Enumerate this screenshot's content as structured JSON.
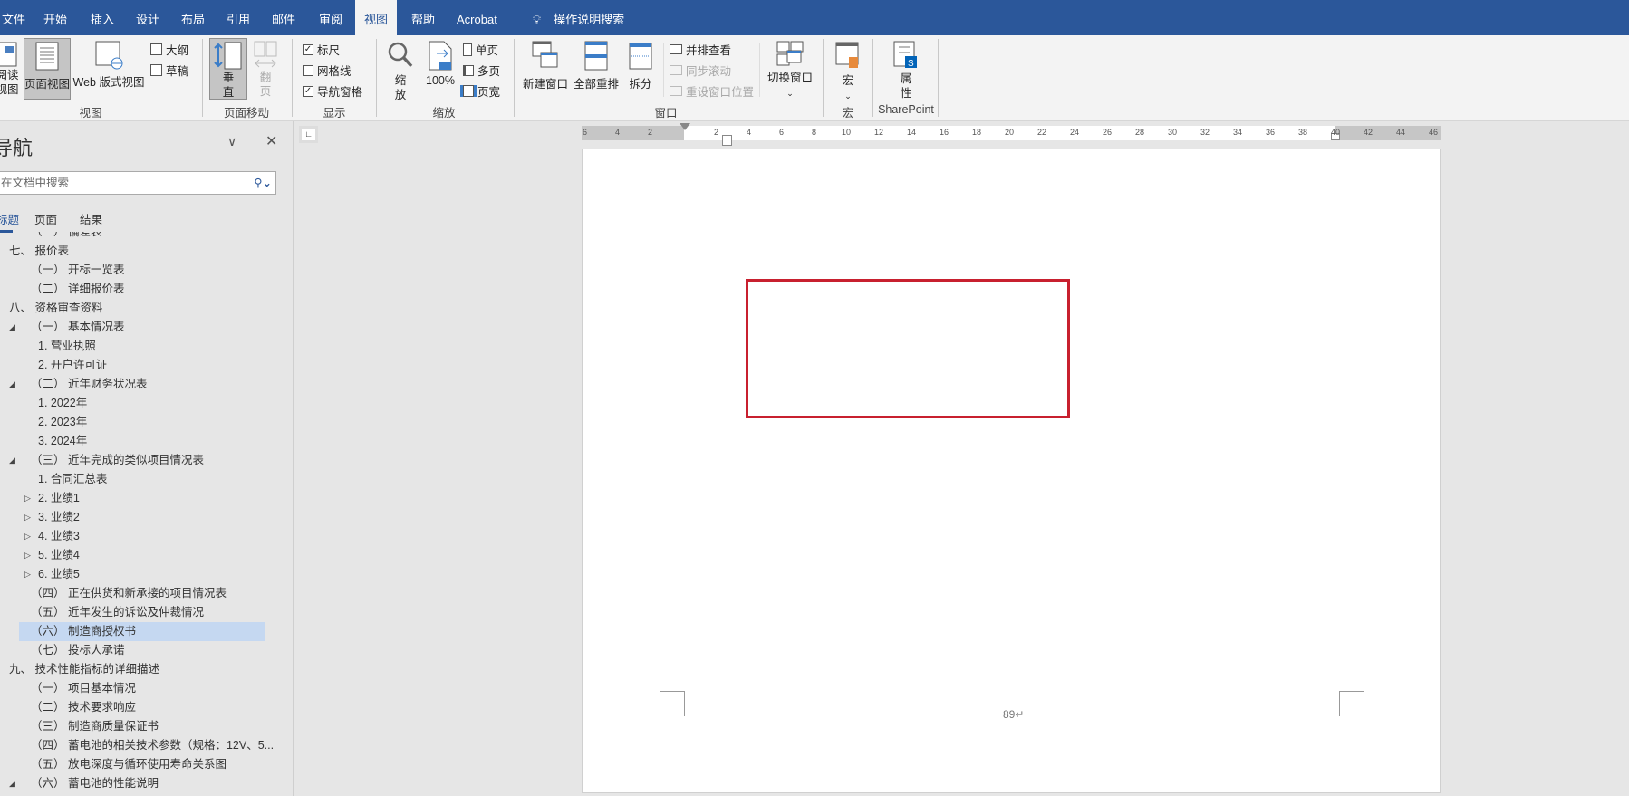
{
  "tabs": [
    "文件",
    "开始",
    "插入",
    "设计",
    "布局",
    "引用",
    "邮件",
    "审阅",
    "视图",
    "帮助",
    "Acrobat"
  ],
  "active_tab": "视图",
  "tell_me": "操作说明搜索",
  "ribbon": {
    "views": {
      "read_mode": "阅读\n视图",
      "print_layout": "页面视图",
      "web_layout": "Web 版式视图",
      "outline": "大纲",
      "draft": "草稿",
      "label": "视图"
    },
    "page_movement": {
      "vertical": "垂\n直",
      "side_to_side": "翻\n页",
      "label": "页面移动"
    },
    "show": {
      "ruler": "标尺",
      "ruler_checked": true,
      "gridlines": "网格线",
      "gridlines_checked": false,
      "nav_pane": "导航窗格",
      "nav_pane_checked": true,
      "label": "显示"
    },
    "zoom": {
      "zoom": "缩\n放",
      "hundred": "100%",
      "one_page": "单页",
      "multiple_pages": "多页",
      "page_width": "页宽",
      "label": "缩放"
    },
    "window": {
      "new_window": "新建窗口",
      "arrange_all": "全部重排",
      "split": "拆分",
      "side_by_side": "并排查看",
      "sync_scroll": "同步滚动",
      "reset_position": "重设窗口位置",
      "switch_windows": "切换窗口",
      "label": "窗口"
    },
    "macros": {
      "macros": "宏",
      "label": "宏"
    },
    "sharepoint": {
      "properties": "属\n性",
      "label": "SharePoint"
    }
  },
  "nav": {
    "title": "导航",
    "search_placeholder": "在文档中搜索",
    "tabs": [
      "标题",
      "页面",
      "结果"
    ],
    "items": [
      {
        "text": "（二）  偏差表",
        "indent": 2
      },
      {
        "text": "七、 报价表",
        "indent": 1
      },
      {
        "text": "（一）  开标一览表",
        "indent": 2
      },
      {
        "text": "（二）  详细报价表",
        "indent": 2
      },
      {
        "text": "八、 资格审查资料",
        "indent": 1
      },
      {
        "text": "（一）  基本情况表",
        "indent": 2,
        "toggle": "expanded"
      },
      {
        "text": "1. 营业执照",
        "indent": 3
      },
      {
        "text": "2. 开户许可证",
        "indent": 3
      },
      {
        "text": "（二）  近年财务状况表",
        "indent": 2,
        "toggle": "expanded"
      },
      {
        "text": "1. 2022年",
        "indent": 3
      },
      {
        "text": "2. 2023年",
        "indent": 3
      },
      {
        "text": "3. 2024年",
        "indent": 3
      },
      {
        "text": "（三）  近年完成的类似项目情况表",
        "indent": 2,
        "toggle": "expanded"
      },
      {
        "text": "1. 合同汇总表",
        "indent": 3
      },
      {
        "text": "2. 业绩1",
        "indent": 3,
        "toggle": "collapsed"
      },
      {
        "text": "3. 业绩2",
        "indent": 3,
        "toggle": "collapsed"
      },
      {
        "text": "4. 业绩3",
        "indent": 3,
        "toggle": "collapsed"
      },
      {
        "text": "5. 业绩4",
        "indent": 3,
        "toggle": "collapsed"
      },
      {
        "text": "6. 业绩5",
        "indent": 3,
        "toggle": "collapsed"
      },
      {
        "text": "（四）  正在供货和新承接的项目情况表",
        "indent": 2
      },
      {
        "text": "（五）  近年发生的诉讼及仲裁情况",
        "indent": 2
      },
      {
        "text": "（六）  制造商授权书",
        "indent": 2,
        "selected": true
      },
      {
        "text": "（七）  投标人承诺",
        "indent": 2
      },
      {
        "text": "九、 技术性能指标的详细描述",
        "indent": 1
      },
      {
        "text": "（一）  项目基本情况",
        "indent": 2
      },
      {
        "text": "（二）  技术要求响应",
        "indent": 2
      },
      {
        "text": "（三）  制造商质量保证书",
        "indent": 2
      },
      {
        "text": "（四）  蓄电池的相关技术参数（规格：12V、5...",
        "indent": 2
      },
      {
        "text": "（五）  放电深度与循环使用寿命关系图",
        "indent": 2
      },
      {
        "text": "（六）  蓄电池的性能说明",
        "indent": 2,
        "toggle": "expanded"
      }
    ]
  },
  "ruler": {
    "left_numbers": [
      "6",
      "4",
      "2"
    ],
    "numbers": [
      "2",
      "4",
      "6",
      "8",
      "10",
      "12",
      "14",
      "16",
      "18",
      "20",
      "22",
      "24",
      "26",
      "28",
      "30",
      "32",
      "34",
      "36",
      "38",
      "40"
    ],
    "right_numbers": [
      "42",
      "44",
      "46"
    ]
  },
  "document": {
    "page_number": "89↵",
    "highlight_color": "#c8202f"
  }
}
